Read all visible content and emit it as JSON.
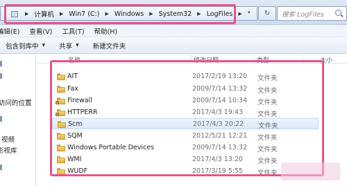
{
  "address": {
    "crumbs": [
      "计算机",
      "Win7 (C:)",
      "Windows",
      "System32",
      "LogFiles"
    ],
    "dropdown_glyph": "▾",
    "refresh_glyph": "↻"
  },
  "search": {
    "placeholder": "搜索 LogFiles"
  },
  "menu": {
    "items": [
      "编辑(E)",
      "查看(V)",
      "工具(T)",
      "帮助(H)"
    ]
  },
  "toolbar": {
    "buttons": [
      {
        "label": "包含到库中",
        "has_caret": true
      },
      {
        "label": "共享",
        "has_caret": true
      },
      {
        "label": "新建文件夹",
        "has_caret": false
      }
    ],
    "caret_glyph": "▼"
  },
  "nav": {
    "items": [
      "访问的位置",
      "视频",
      "影视库"
    ]
  },
  "columns": {
    "name": "名称",
    "modified": "修改日期",
    "type": "类型",
    "size": "大小"
  },
  "files": [
    {
      "name": "AIT",
      "modified": "2017/2/19 13:20",
      "type": "文件夹",
      "locked": false
    },
    {
      "name": "Fax",
      "modified": "2009/7/14 13:32",
      "type": "文件夹",
      "locked": false
    },
    {
      "name": "Firewall",
      "modified": "2009/7/14 10:34",
      "type": "文件夹",
      "locked": true
    },
    {
      "name": "HTTPERR",
      "modified": "2017/4/3 19:43",
      "type": "文件夹",
      "locked": true
    },
    {
      "name": "Scm",
      "modified": "2017/4/3 20:22",
      "type": "文件夹",
      "locked": false
    },
    {
      "name": "SQM",
      "modified": "2012/5/21 12:21",
      "type": "文件夹",
      "locked": false
    },
    {
      "name": "Windows Portable Devices",
      "modified": "2009/7/14 13:32",
      "type": "文件夹",
      "locked": false
    },
    {
      "name": "WMI",
      "modified": "2017/4/3 13:20",
      "type": "文件夹",
      "locked": false
    },
    {
      "name": "WUDF",
      "modified": "2017/3/19 5:55",
      "type": "文件夹",
      "locked": false
    }
  ],
  "selected_file": "Scm",
  "colors": {
    "highlight": "#e8528b",
    "selection": "#dbe9f8"
  }
}
